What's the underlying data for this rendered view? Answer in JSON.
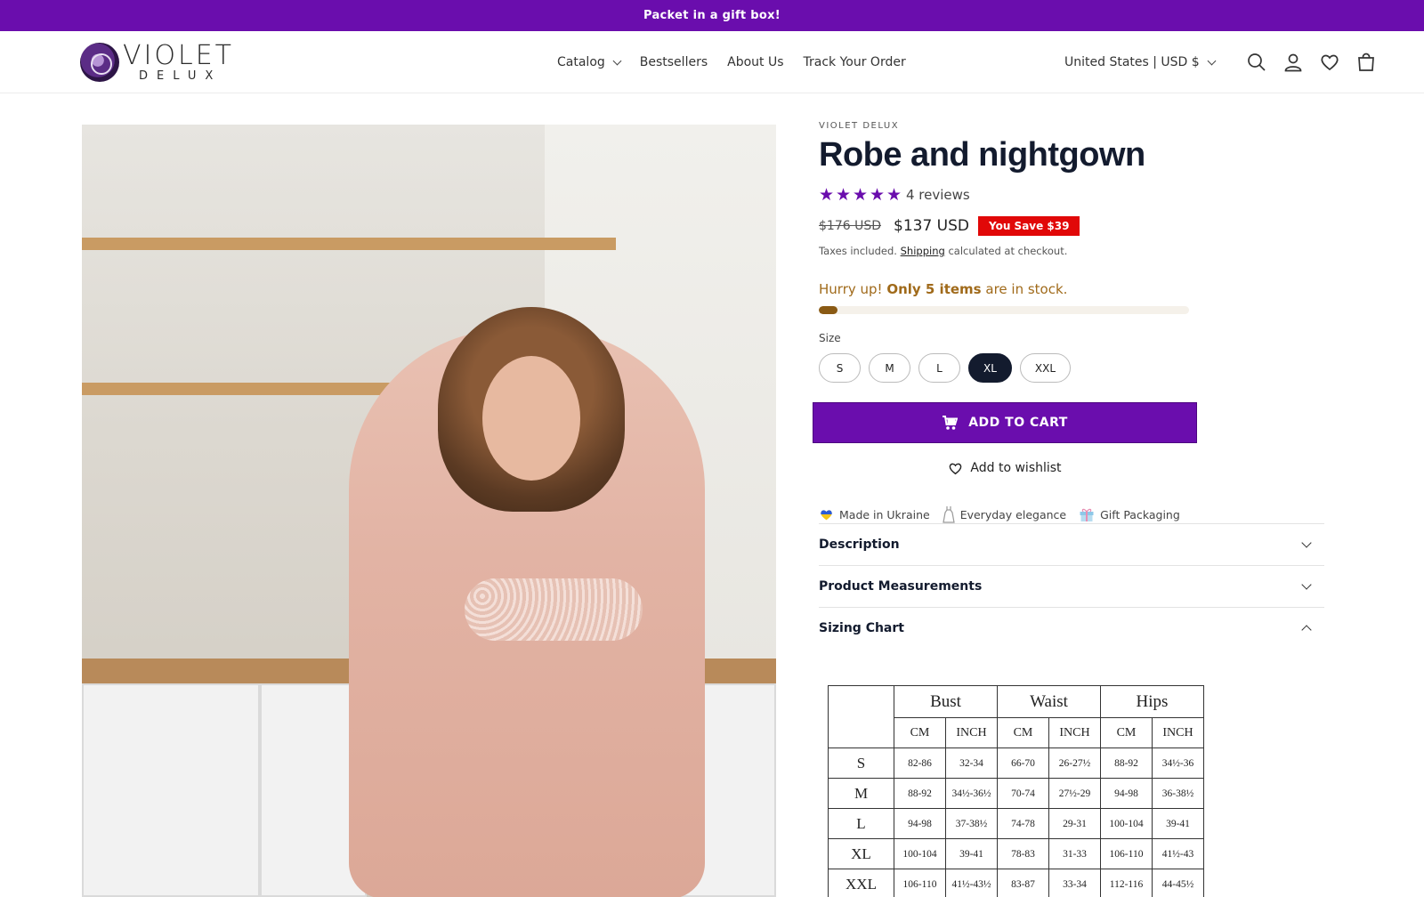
{
  "announcement": "Packet in a gift box!",
  "brand": {
    "name": "VIOLET",
    "sub": "DELUX"
  },
  "nav": [
    {
      "label": "Catalog",
      "has_dropdown": true
    },
    {
      "label": "Bestsellers"
    },
    {
      "label": "About Us"
    },
    {
      "label": "Track Your Order"
    }
  ],
  "header": {
    "locale": "United States | USD $",
    "icons": [
      "search-icon",
      "account-icon",
      "wishlist-icon",
      "cart-icon"
    ]
  },
  "product": {
    "vendor": "VIOLET DELUX",
    "title": "Robe and nightgown",
    "rating": 5,
    "reviews": "4 reviews",
    "compare_price": "$176 USD",
    "price": "$137 USD",
    "save_badge": "You Save $39",
    "tax_prefix": "Taxes included.",
    "tax_link": "Shipping",
    "tax_suffix": "calculated at checkout.",
    "stock_prefix": "Hurry up!",
    "stock_bold": "Only 5 items",
    "stock_suffix": "are in stock.",
    "stock_level": 0.05,
    "size_label": "Size",
    "sizes": [
      "S",
      "M",
      "L",
      "XL",
      "XXL"
    ],
    "selected_size": "XL",
    "add_to_cart": "ADD TO CART",
    "wishlist": "Add to wishlist",
    "features": [
      "Made in Ukraine",
      "Everyday elegance",
      "Gift Packaging"
    ],
    "accordions": [
      {
        "label": "Description",
        "open": false
      },
      {
        "label": "Product Measurements",
        "open": false
      },
      {
        "label": "Sizing Chart",
        "open": true
      }
    ]
  },
  "sizing_chart": {
    "groups": [
      "Bust",
      "Waist",
      "Hips"
    ],
    "units": [
      "CM",
      "INCH",
      "CM",
      "INCH",
      "CM",
      "INCH"
    ],
    "rows": [
      {
        "size": "S",
        "values": [
          "82-86",
          "32-34",
          "66-70",
          "26-27½",
          "88-92",
          "34½-36"
        ]
      },
      {
        "size": "M",
        "values": [
          "88-92",
          "34½-36½",
          "70-74",
          "27½-29",
          "94-98",
          "36-38½"
        ]
      },
      {
        "size": "L",
        "values": [
          "94-98",
          "37-38½",
          "74-78",
          "29-31",
          "100-104",
          "39-41"
        ]
      },
      {
        "size": "XL",
        "values": [
          "100-104",
          "39-41",
          "78-83",
          "31-33",
          "106-110",
          "41½-43"
        ]
      },
      {
        "size": "XXL",
        "values": [
          "106-110",
          "41½-43½",
          "83-87",
          "33-34",
          "112-116",
          "44-45½"
        ]
      }
    ]
  },
  "colors": {
    "accent": "#6a0dad",
    "dark": "#131b2e",
    "sale": "#e10808",
    "stock": "#a06a1a"
  }
}
